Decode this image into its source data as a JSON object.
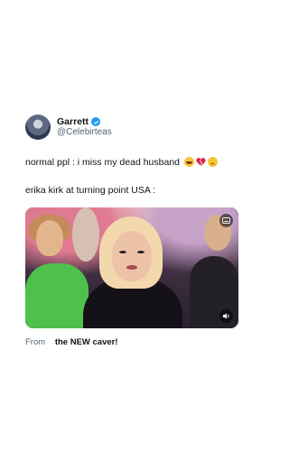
{
  "author": {
    "display_name": "Garrett",
    "handle": "@Celebirteas",
    "verified": true,
    "verified_color": "#1d9bf0"
  },
  "tweet": {
    "line1": "normal ppl : i miss my dead husband",
    "line1_emojis": [
      "laughing-crying-emoji",
      "broken-heart-emoji",
      "sad-tear-emoji"
    ],
    "line2": "erika kirk at turning point USA :"
  },
  "media": {
    "type": "video",
    "badge_top_icon": "caption-icon",
    "badge_bottom_icon": "volume-icon"
  },
  "caption": {
    "from_label": "From",
    "source_title": "the NEW caver!"
  }
}
